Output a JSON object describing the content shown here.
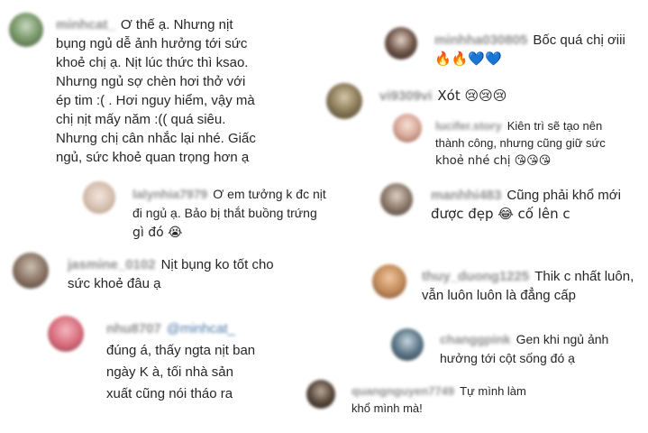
{
  "comments": [
    {
      "username": "minhcat_",
      "lines": [
        "Ơ thế ạ. Nhưng nịt",
        "bụng ngủ dễ ảnh hưởng tới sức",
        "khoẻ chị ạ. Nịt lúc thức thì ksao.",
        "Nhưng ngủ sợ chèn hơi thở với",
        "ép tim :( . Hơi nguy hiểm, vậy mà",
        "chị nịt mấy năm :(( quá siêu.",
        "Nhưng chị cân nhắc lại nhé. Giấc",
        "ngủ, sức khoẻ quan trọng hơn ạ"
      ]
    },
    {
      "username": "lalynhia7979",
      "lines": [
        "Ơ em tưởng k đc nịt",
        "đi ngủ ạ. Bảo bị thắt buồng trứng",
        "gì đó 😭"
      ]
    },
    {
      "username": "jasmine_0102",
      "lines": [
        "Nịt bụng ko tốt cho",
        "sức khoẻ đâu ạ"
      ]
    },
    {
      "username": "nhu8707",
      "mention": "@minhcat_",
      "lines": [
        "đúng á, thấy ngta nịt ban",
        "ngày K à, tối nhà sản",
        "xuất cũng nói tháo ra"
      ]
    },
    {
      "username": "minhha030805",
      "lines": [
        "Bốc quá chị ơiii",
        "🔥🔥💙💙"
      ]
    },
    {
      "username": "vi9309vi",
      "lines": [
        "Xót 😢😢😢"
      ]
    },
    {
      "username": "lucifer.story",
      "lines": [
        "Kiên trì sẽ tạo nên",
        "thành công, nhưng cũng giữ sức",
        "khoẻ nhé chị 😘😘😘"
      ]
    },
    {
      "username": "manhhi483",
      "lines": [
        "Cũng phải khổ mới",
        "được đẹp 😂 cố lên c"
      ]
    },
    {
      "username": "thuy_duong1225",
      "lines": [
        "Thik c nhất luôn,",
        "vẫn luôn luôn là đẳng cấp"
      ]
    },
    {
      "username": "changgpink",
      "lines": [
        "Gen khi ngủ ảnh",
        "hưởng tới cột sống đó ạ"
      ]
    },
    {
      "username": "quangnguyen7749",
      "lines": [
        "Tự mình làm",
        "khổ mình mà!"
      ]
    }
  ],
  "colors": {
    "text": "#262626",
    "username": "#8e8e8e",
    "mention": "#4e78a8"
  }
}
